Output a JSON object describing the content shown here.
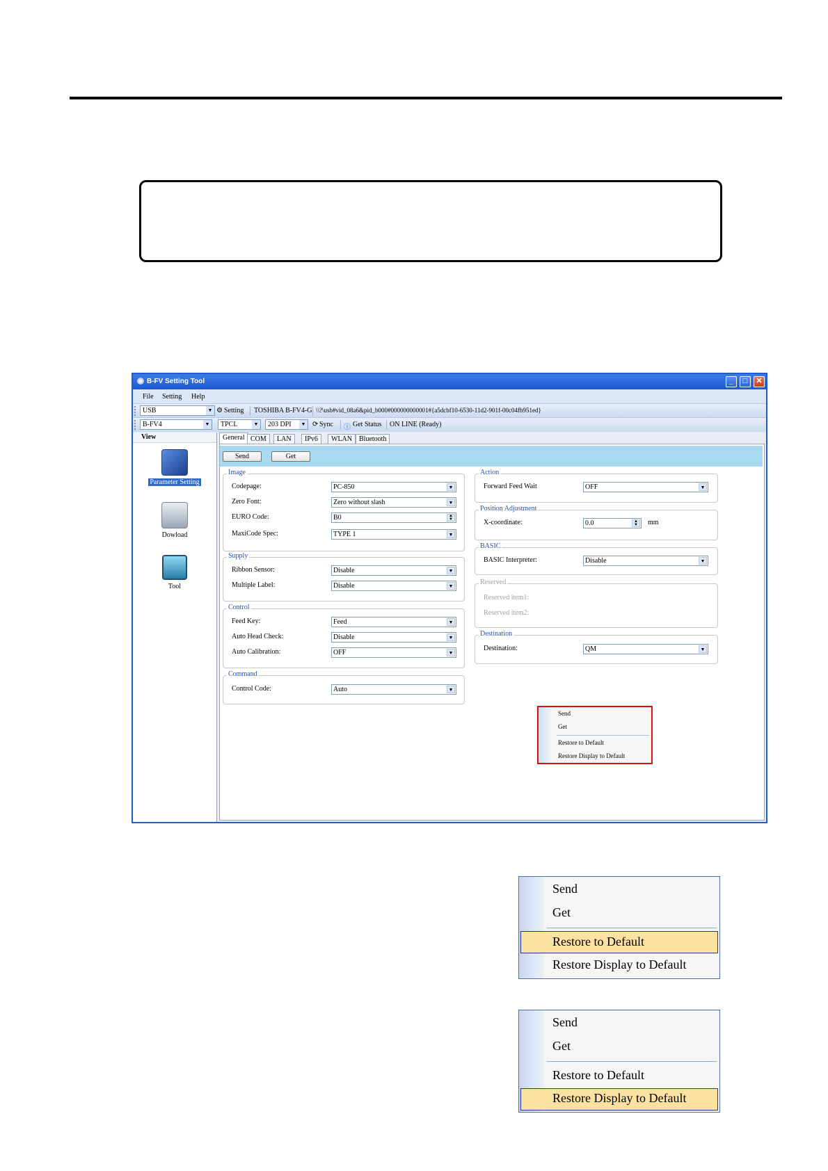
{
  "window": {
    "title": "B-FV Setting Tool",
    "buttons": {
      "minimize": "_",
      "maximize": "□",
      "close": "✕"
    }
  },
  "menubar": {
    "items": [
      "File",
      "Setting",
      "Help"
    ]
  },
  "toolbar1": {
    "port": "USB",
    "setting_label": "Setting",
    "printer_name": "TOSHIBA B-FV4-G",
    "device_path": "\\\\?\\usb#vid_08a6&pid_b000#000000000001#{a5dcbf10-6530-11d2-901f-00c04fb951ed}"
  },
  "toolbar2": {
    "model": "B-FV4",
    "language": "TPCL",
    "dpi": "203 DPI",
    "sync_label": "Sync",
    "get_status_label": "Get Status",
    "status_text": "ON LINE (Ready)"
  },
  "left_panel": {
    "header": "View",
    "items": [
      {
        "label": "Parameter Setting",
        "icon": "parameter-setting-icon"
      },
      {
        "label": "Dowload",
        "icon": "download-icon"
      },
      {
        "label": "Tool",
        "icon": "tool-icon"
      }
    ]
  },
  "tabs": [
    "General",
    "COM",
    "LAN",
    "IPv6",
    "WLAN",
    "Bluetooth"
  ],
  "action_buttons": {
    "send": "Send",
    "get": "Get"
  },
  "groups": {
    "image": {
      "title": "Image",
      "rows": [
        {
          "label": "Codepage:",
          "value": "PC-850"
        },
        {
          "label": "Zero Font:",
          "value": "Zero without slash"
        },
        {
          "label": "EURO Code:",
          "value": "B0"
        },
        {
          "label": "MaxiCode Spec:",
          "value": "TYPE 1"
        }
      ]
    },
    "supply": {
      "title": "Supply",
      "rows": [
        {
          "label": "Ribbon Sensor:",
          "value": "Disable"
        },
        {
          "label": "Multiple Label:",
          "value": "Disable"
        }
      ]
    },
    "control": {
      "title": "Control",
      "rows": [
        {
          "label": "Feed Key:",
          "value": "Feed"
        },
        {
          "label": "Auto Head Check:",
          "value": "Disable"
        },
        {
          "label": "Auto Calibration:",
          "value": "OFF"
        }
      ]
    },
    "command": {
      "title": "Command",
      "rows": [
        {
          "label": "Control Code:",
          "value": "Auto"
        }
      ]
    },
    "action": {
      "title": "Action",
      "rows": [
        {
          "label": "Forward Feed Wait",
          "value": "OFF"
        }
      ]
    },
    "position": {
      "title": "Position Adjustment",
      "rows": [
        {
          "label": "X-coordinate:",
          "value": "0.0",
          "unit": "mm"
        }
      ]
    },
    "basic": {
      "title": "BASIC",
      "rows": [
        {
          "label": "BASIC Interpreter:",
          "value": "Disable"
        }
      ]
    },
    "reserved": {
      "title": "Reserved",
      "rows": [
        {
          "label": "Reserved item1:"
        },
        {
          "label": "Reserved item2:"
        }
      ]
    },
    "destination": {
      "title": "Destination",
      "rows": [
        {
          "label": "Destination:",
          "value": "QM"
        }
      ]
    }
  },
  "context_menu": {
    "items": [
      "Send",
      "Get",
      "Restore to Default",
      "Restore Display to Default"
    ],
    "accent": "#e01010"
  },
  "zoom_menu_1": {
    "items": [
      "Send",
      "Get",
      "Restore to Default",
      "Restore Display to Default"
    ],
    "highlighted": "Restore to Default"
  },
  "zoom_menu_2": {
    "items": [
      "Send",
      "Get",
      "Restore to Default",
      "Restore Display to Default"
    ],
    "highlighted": "Restore Display to Default"
  },
  "colors": {
    "title_bar": "#1d58d4",
    "button_bar": "#a9dbf0",
    "highlight": "#fbe2a0"
  }
}
